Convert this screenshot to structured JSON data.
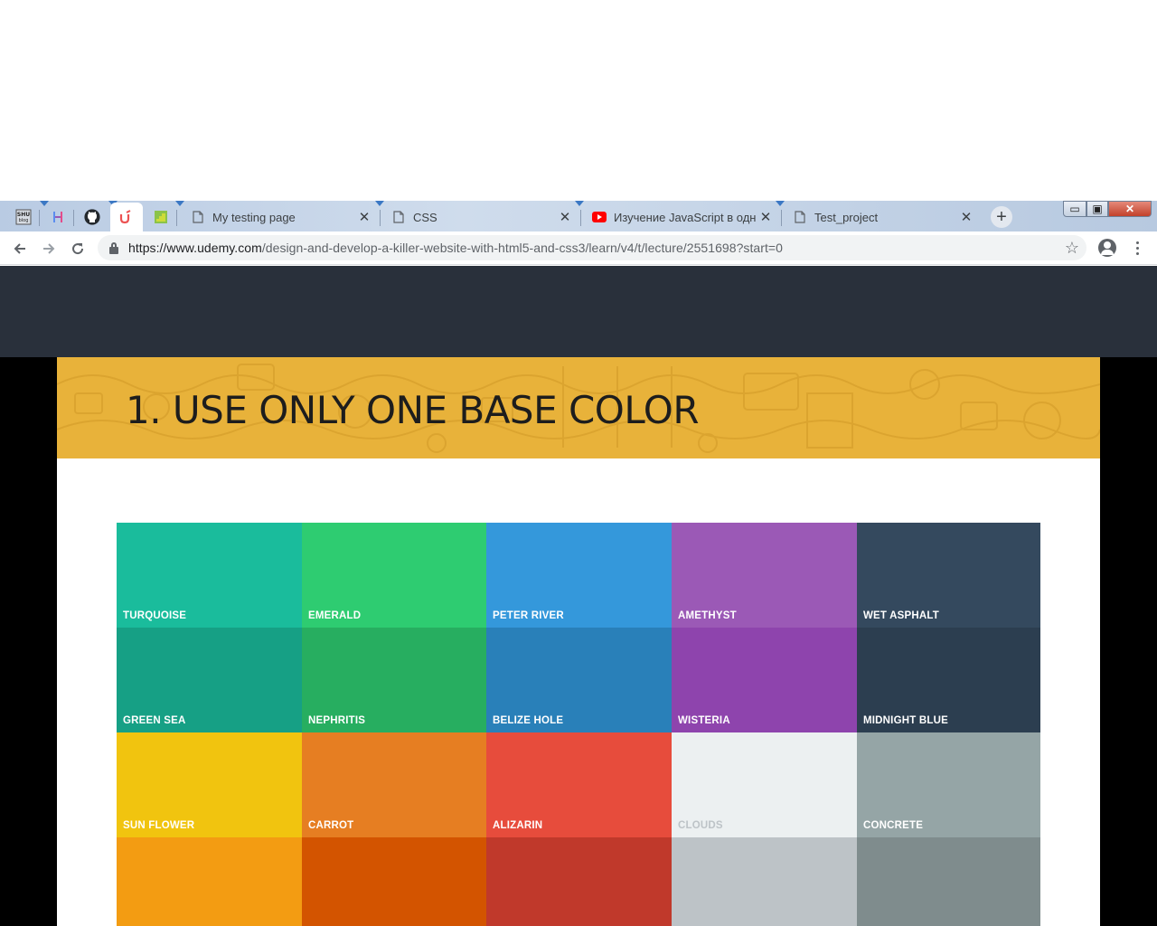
{
  "browser": {
    "pinned_tabs": [
      {
        "name": "shu-blog",
        "icon": "shu-blog-icon"
      },
      {
        "name": "h-app",
        "icon": "h-icon"
      },
      {
        "name": "github",
        "icon": "github-icon"
      },
      {
        "name": "udemy",
        "icon": "udemy-icon",
        "active": true
      },
      {
        "name": "green-app",
        "icon": "green-stairs-icon"
      }
    ],
    "tabs": [
      {
        "title": "My testing page",
        "icon": "page-icon"
      },
      {
        "title": "CSS",
        "icon": "page-icon"
      },
      {
        "title": "Изучение JavaScript в одном",
        "icon": "youtube-icon"
      },
      {
        "title": "Test_project",
        "icon": "page-icon"
      }
    ],
    "address": {
      "scheme_host": "https://www.udemy.com",
      "path": "/design-and-develop-a-killer-website-with-html5-and-css3/learn/v4/t/lecture/2551698?start=0"
    },
    "window_controls": {
      "minimize": "▭",
      "maximize": "▣",
      "close": "✕"
    }
  },
  "slide": {
    "title": "1. USE ONLY ONE BASE COLOR",
    "banner_color": "#e8b23a",
    "colors": [
      {
        "name": "TURQUOISE",
        "hex": "#1abc9c"
      },
      {
        "name": "EMERALD",
        "hex": "#2ecc71"
      },
      {
        "name": "PETER RIVER",
        "hex": "#3498db"
      },
      {
        "name": "AMETHYST",
        "hex": "#9b59b6"
      },
      {
        "name": "WET ASPHALT",
        "hex": "#34495e"
      },
      {
        "name": "GREEN SEA",
        "hex": "#16a085"
      },
      {
        "name": "NEPHRITIS",
        "hex": "#27ae60"
      },
      {
        "name": "BELIZE HOLE",
        "hex": "#2980b9"
      },
      {
        "name": "WISTERIA",
        "hex": "#8e44ad"
      },
      {
        "name": "MIDNIGHT BLUE",
        "hex": "#2c3e50"
      },
      {
        "name": "SUN FLOWER",
        "hex": "#f1c40f"
      },
      {
        "name": "CARROT",
        "hex": "#e67e22"
      },
      {
        "name": "ALIZARIN",
        "hex": "#e74c3c"
      },
      {
        "name": "CLOUDS",
        "hex": "#ecf0f1",
        "light": true
      },
      {
        "name": "CONCRETE",
        "hex": "#95a5a6"
      },
      {
        "name": "",
        "hex": "#f39c12"
      },
      {
        "name": "",
        "hex": "#d35400"
      },
      {
        "name": "",
        "hex": "#c0392b"
      },
      {
        "name": "",
        "hex": "#bdc3c7"
      },
      {
        "name": "",
        "hex": "#7f8c8d"
      }
    ]
  }
}
